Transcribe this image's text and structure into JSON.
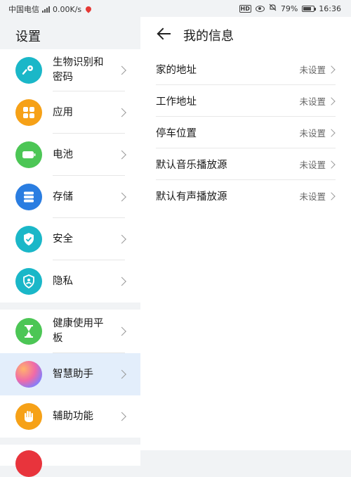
{
  "status_bar": {
    "carrier": "中国电信",
    "net_speed": "0.00K/s",
    "hd": "HD",
    "battery_pct": "79%",
    "time": "16:36"
  },
  "left": {
    "title": "设置",
    "items": [
      {
        "label": "生物识别和密码",
        "icon": "key-icon",
        "color": "#1ab7c8"
      },
      {
        "label": "应用",
        "icon": "apps-icon",
        "color": "#f6a117"
      },
      {
        "label": "电池",
        "icon": "battery-icon",
        "color": "#4cc655"
      },
      {
        "label": "存储",
        "icon": "storage-icon",
        "color": "#2a7de1"
      },
      {
        "label": "安全",
        "icon": "shield-check-icon",
        "color": "#1ab7c8"
      },
      {
        "label": "隐私",
        "icon": "privacy-icon",
        "color": "#1ab7c8"
      },
      {
        "label": "健康使用平板",
        "icon": "hourglass-icon",
        "color": "#4cc655"
      },
      {
        "label": "智慧助手",
        "icon": "assistant-icon",
        "color": "#9b7be8"
      },
      {
        "label": "辅助功能",
        "icon": "hand-icon",
        "color": "#f6a117"
      }
    ]
  },
  "right": {
    "title": "我的信息",
    "rows": [
      {
        "label": "家的地址",
        "value": "未设置"
      },
      {
        "label": "工作地址",
        "value": "未设置"
      },
      {
        "label": "停车位置",
        "value": "未设置"
      },
      {
        "label": "默认音乐播放源",
        "value": "未设置"
      },
      {
        "label": "默认有声播放源",
        "value": "未设置"
      }
    ]
  }
}
